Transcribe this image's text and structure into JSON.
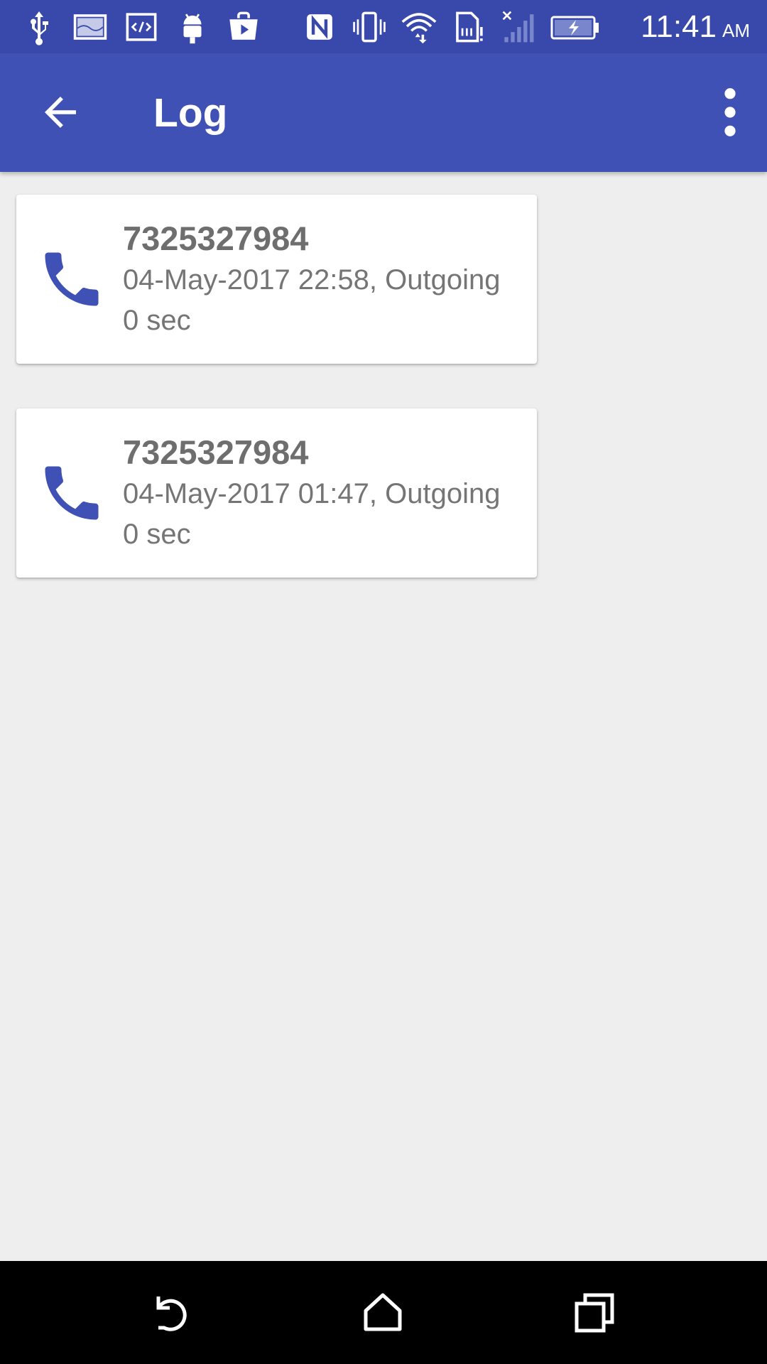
{
  "status_bar": {
    "icons_left": [
      "usb-icon",
      "image-icon",
      "code-icon",
      "android-icon",
      "play-store-bag-icon"
    ],
    "icons_right": [
      "nfc-icon",
      "vibrate-icon",
      "wifi-icon",
      "sim-alert-icon",
      "signal-none-icon",
      "battery-charging-icon"
    ],
    "time": "11:41",
    "ampm": "AM"
  },
  "app_bar": {
    "title": "Log",
    "back_icon": "arrow-back-icon",
    "overflow_icon": "more-vert-icon",
    "color": "#3f51b5",
    "status_color": "#3949ab"
  },
  "log": {
    "items": [
      {
        "icon": "phone-icon",
        "number": "7325327984",
        "meta": "04-May-2017 22:58, Outgoing",
        "duration": "0 sec"
      },
      {
        "icon": "phone-icon",
        "number": "7325327984",
        "meta": "04-May-2017 01:47, Outgoing",
        "duration": "0 sec"
      }
    ],
    "icon_color": "#3f51b5"
  },
  "nav_bar": {
    "buttons": [
      "nav-back-icon",
      "nav-home-icon",
      "nav-recents-icon"
    ]
  }
}
